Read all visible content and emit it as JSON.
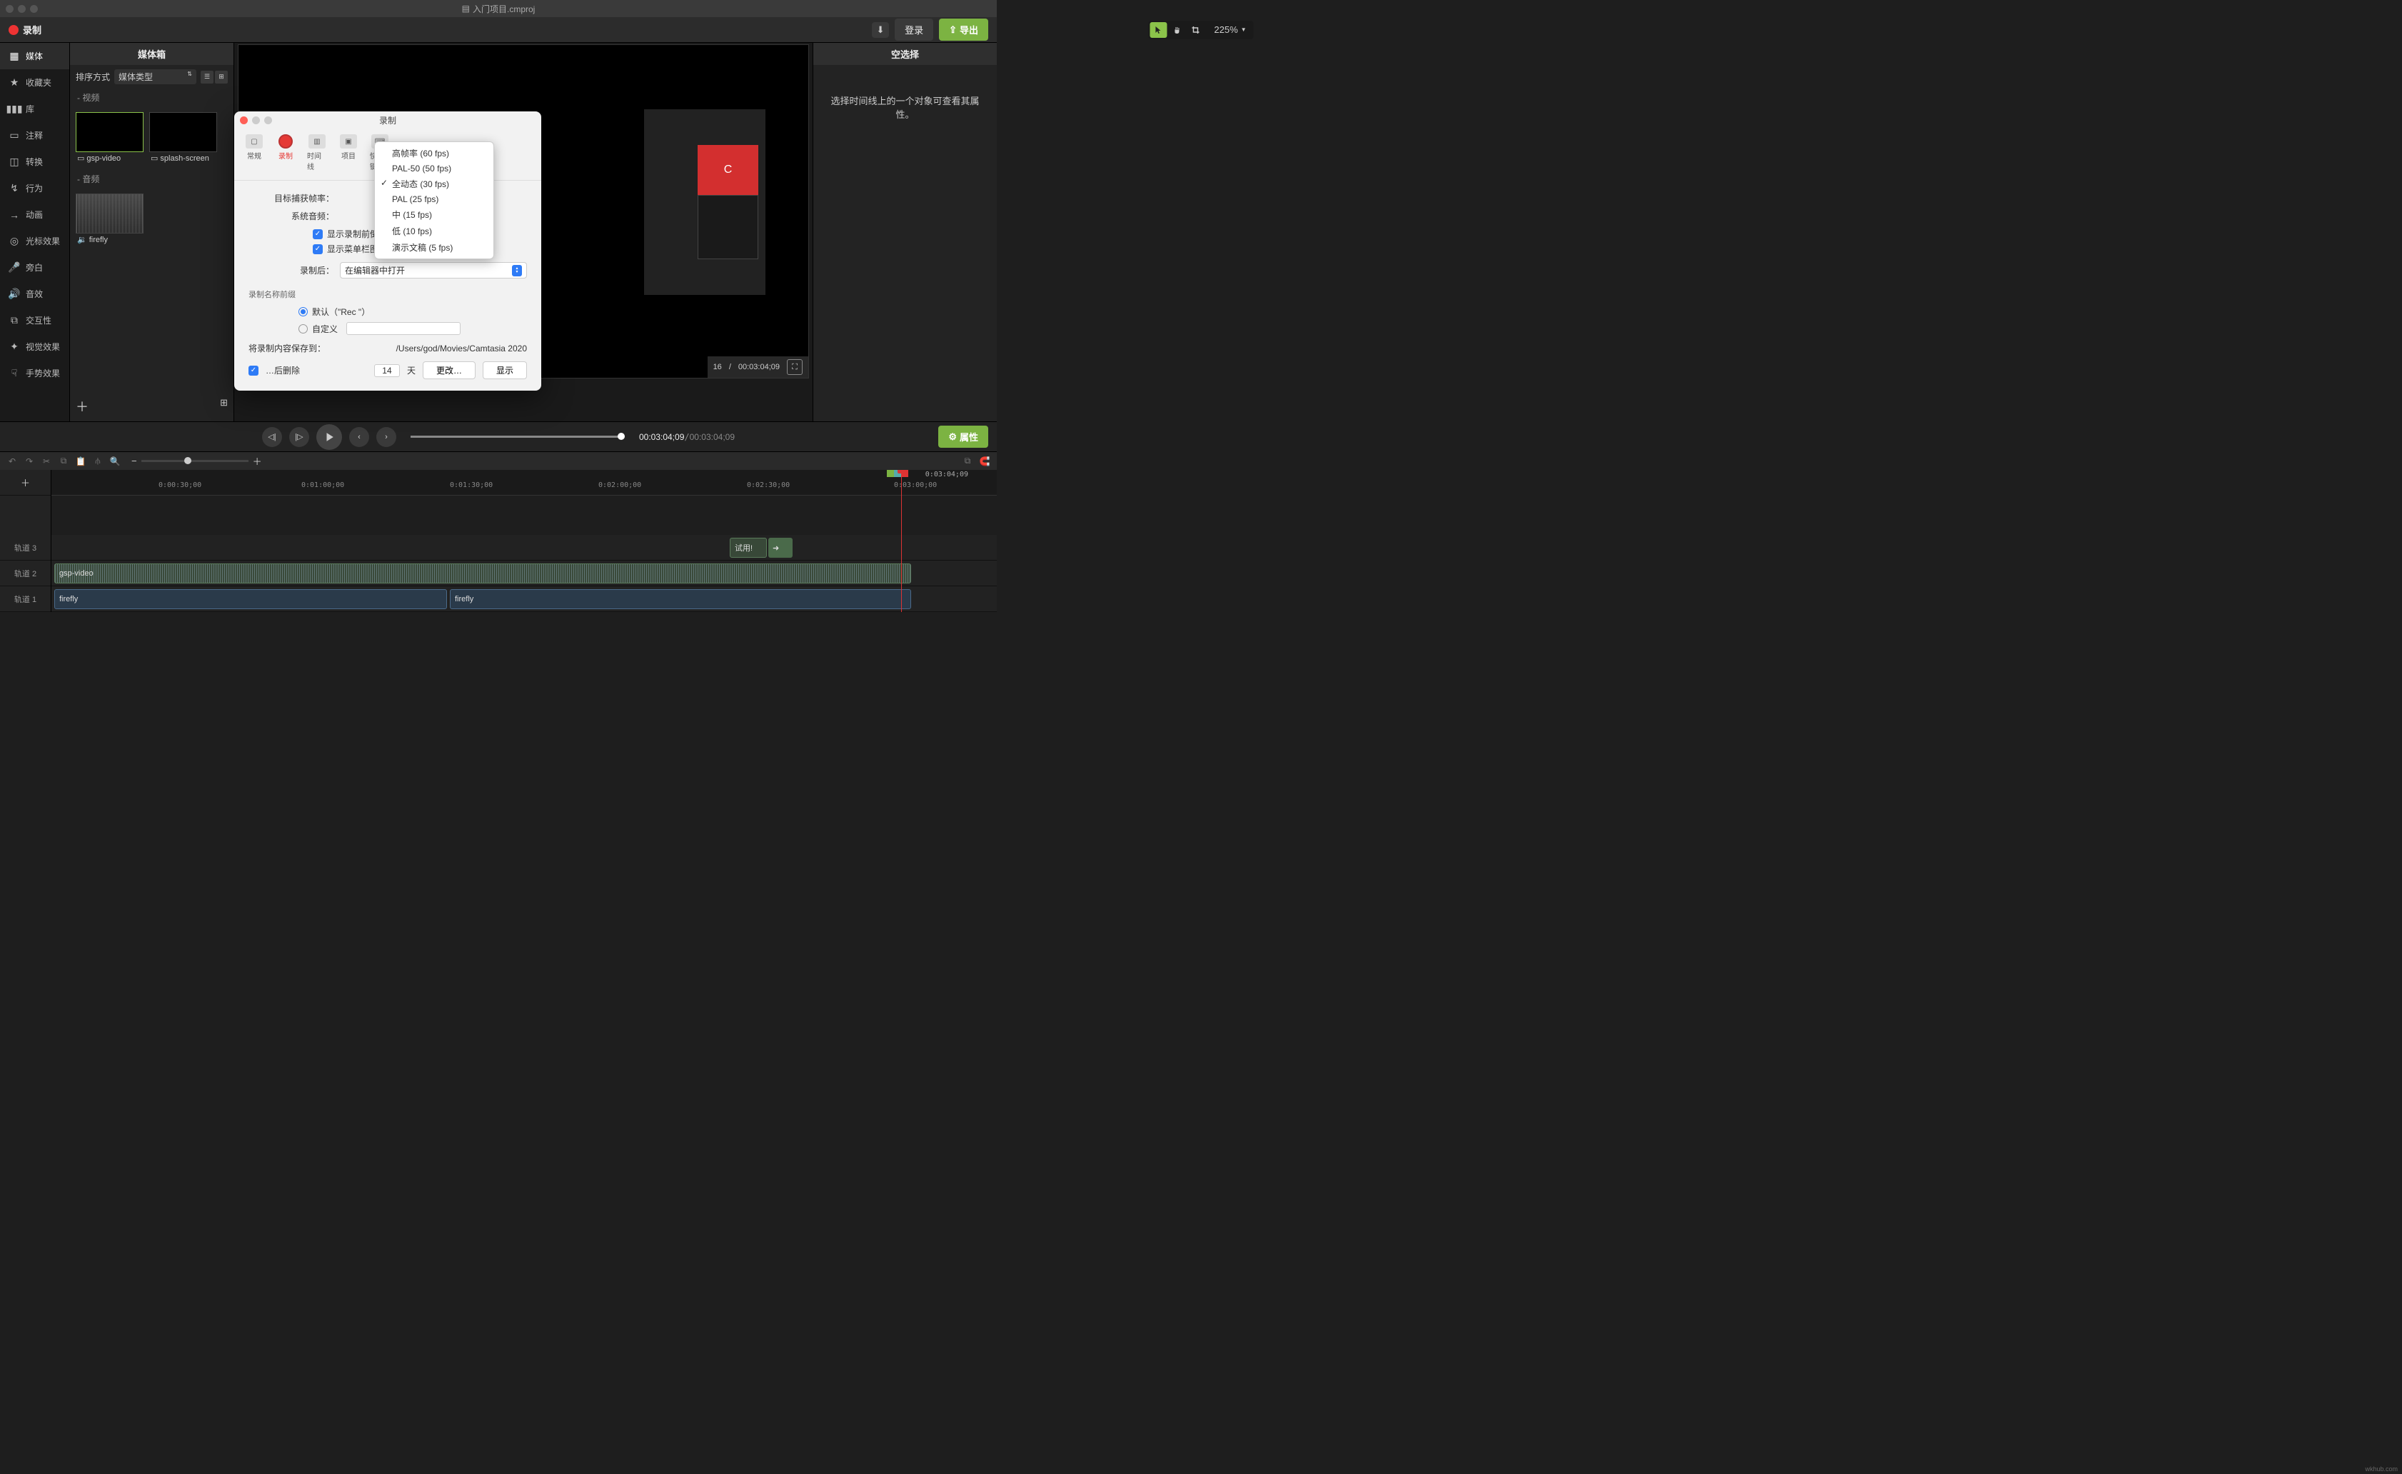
{
  "window": {
    "title": "入门项目.cmproj"
  },
  "toolbar": {
    "record": "录制",
    "zoom": "225%",
    "login": "登录",
    "export": "导出"
  },
  "leftnav": {
    "items": [
      {
        "label": "媒体"
      },
      {
        "label": "收藏夹"
      },
      {
        "label": "库"
      },
      {
        "label": "注释"
      },
      {
        "label": "转换"
      },
      {
        "label": "行为"
      },
      {
        "label": "动画"
      },
      {
        "label": "光标效果"
      },
      {
        "label": "旁白"
      },
      {
        "label": "音效"
      },
      {
        "label": "交互性"
      },
      {
        "label": "视觉效果"
      },
      {
        "label": "手势效果"
      }
    ]
  },
  "mediabin": {
    "title": "媒体箱",
    "sort_label": "排序方式",
    "sort_value": "媒体类型",
    "section_video": "- 视频",
    "section_audio": "- 音频",
    "items_video": [
      {
        "name": "gsp-video"
      },
      {
        "name": "splash-screen"
      }
    ],
    "items_audio": [
      {
        "name": "firefly"
      }
    ]
  },
  "canvas": {
    "preview_letter": "C",
    "info_left": "16",
    "info_time": "00:03:04;09"
  },
  "rightpanel": {
    "title": "空选择",
    "hint": "选择时间线上的一个对象可查看其属性。"
  },
  "playback": {
    "time_current": "00:03:04;09",
    "time_total": "00:03:04;09",
    "properties": "属性"
  },
  "timeline": {
    "ruler_end": "0:03:04;09",
    "labels": [
      "0:00:30;00",
      "0:01:00;00",
      "0:01:30;00",
      "0:02:00;00",
      "0:02:30;00",
      "0:03:00;00"
    ],
    "tracks": [
      {
        "name": "轨道 3"
      },
      {
        "name": "轨道 2"
      },
      {
        "name": "轨道 1"
      }
    ],
    "clips": {
      "track3_annot": "试用!",
      "track2": "gsp-video",
      "track1a": "firefly",
      "track1b": "firefly"
    }
  },
  "pref": {
    "title": "录制",
    "tabs": [
      {
        "label": "常规"
      },
      {
        "label": "录制"
      },
      {
        "label": "时间线"
      },
      {
        "label": "项目"
      },
      {
        "label": "快捷键"
      }
    ],
    "row_fps": "目标捕获帧率：",
    "row_audio": "系统音频：",
    "check_countdown": "显示录制前倒计时",
    "check_menubar": "显示菜单栏图标",
    "row_after": "录制后：",
    "after_value": "在编辑器中打开",
    "group_prefix": "录制名称前缀",
    "radio_default": "默认（\"Rec \"）",
    "radio_custom": "自定义",
    "save_to_label": "将录制内容保存到：",
    "save_path": "/Users/god/Movies/Camtasia 2020",
    "check_delete": "…后删除",
    "delete_days": "14",
    "delete_unit": "天",
    "btn_change": "更改…",
    "btn_show": "显示"
  },
  "fps_menu": {
    "items": [
      "高帧率 (60 fps)",
      "PAL-50 (50 fps)",
      "全动态 (30 fps)",
      "PAL (25 fps)",
      "中 (15 fps)",
      "低 (10 fps)",
      "演示文稿 (5 fps)"
    ],
    "checked_index": 2
  },
  "watermark": "wkhub.com"
}
